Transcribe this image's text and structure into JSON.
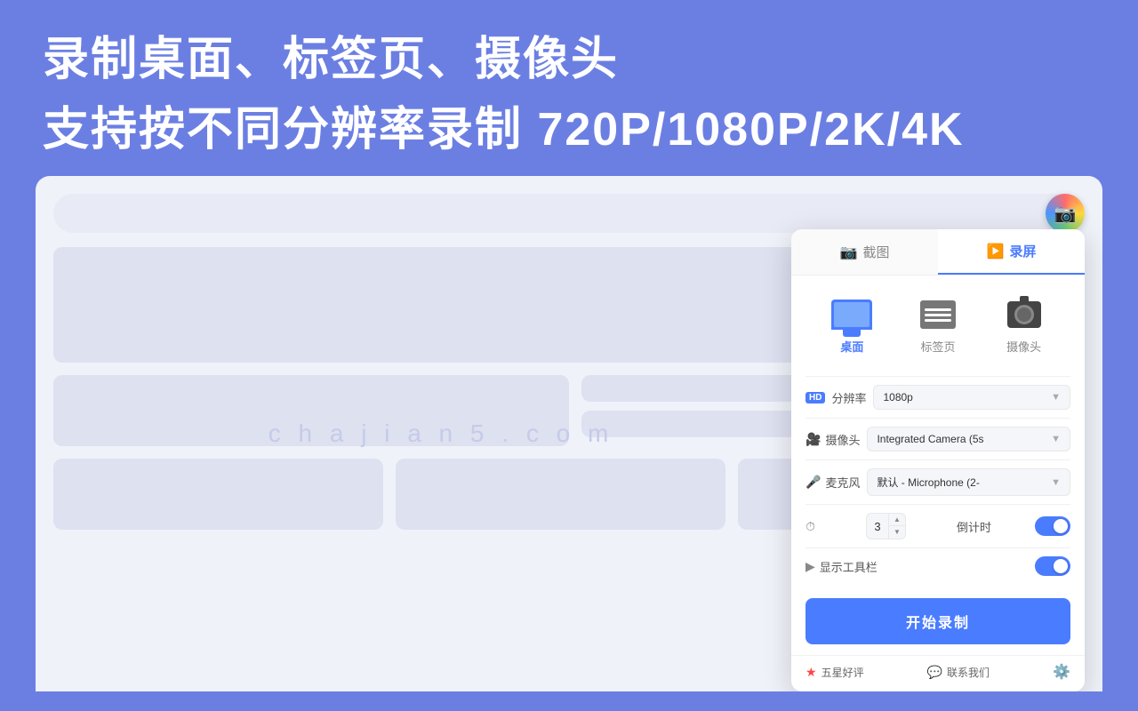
{
  "banner": {
    "title1": "录制桌面、标签页、摄像头",
    "title2": "支持按不同分辨率录制 720P/1080P/2K/4K"
  },
  "address_bar": {
    "placeholder": ""
  },
  "watermark": "c h a j i a n 5 . c o m",
  "panel": {
    "tab_screenshot": "截图",
    "tab_record": "录屏",
    "source_desktop": "桌面",
    "source_tab": "标签页",
    "source_camera": "摄像头",
    "setting_resolution_label": "分辨率",
    "setting_resolution_value": "1080p",
    "setting_camera_label": "摄像头",
    "setting_camera_value": "Integrated Camera (5s",
    "setting_mic_label": "麦克风",
    "setting_mic_value": "默认 - Microphone (2-",
    "setting_countdown_label": "倒计时",
    "setting_countdown_value": "3",
    "setting_toolbar_label": "显示工具栏",
    "start_button": "开始录制",
    "footer_review": "五星好评",
    "footer_contact": "联系我们"
  }
}
